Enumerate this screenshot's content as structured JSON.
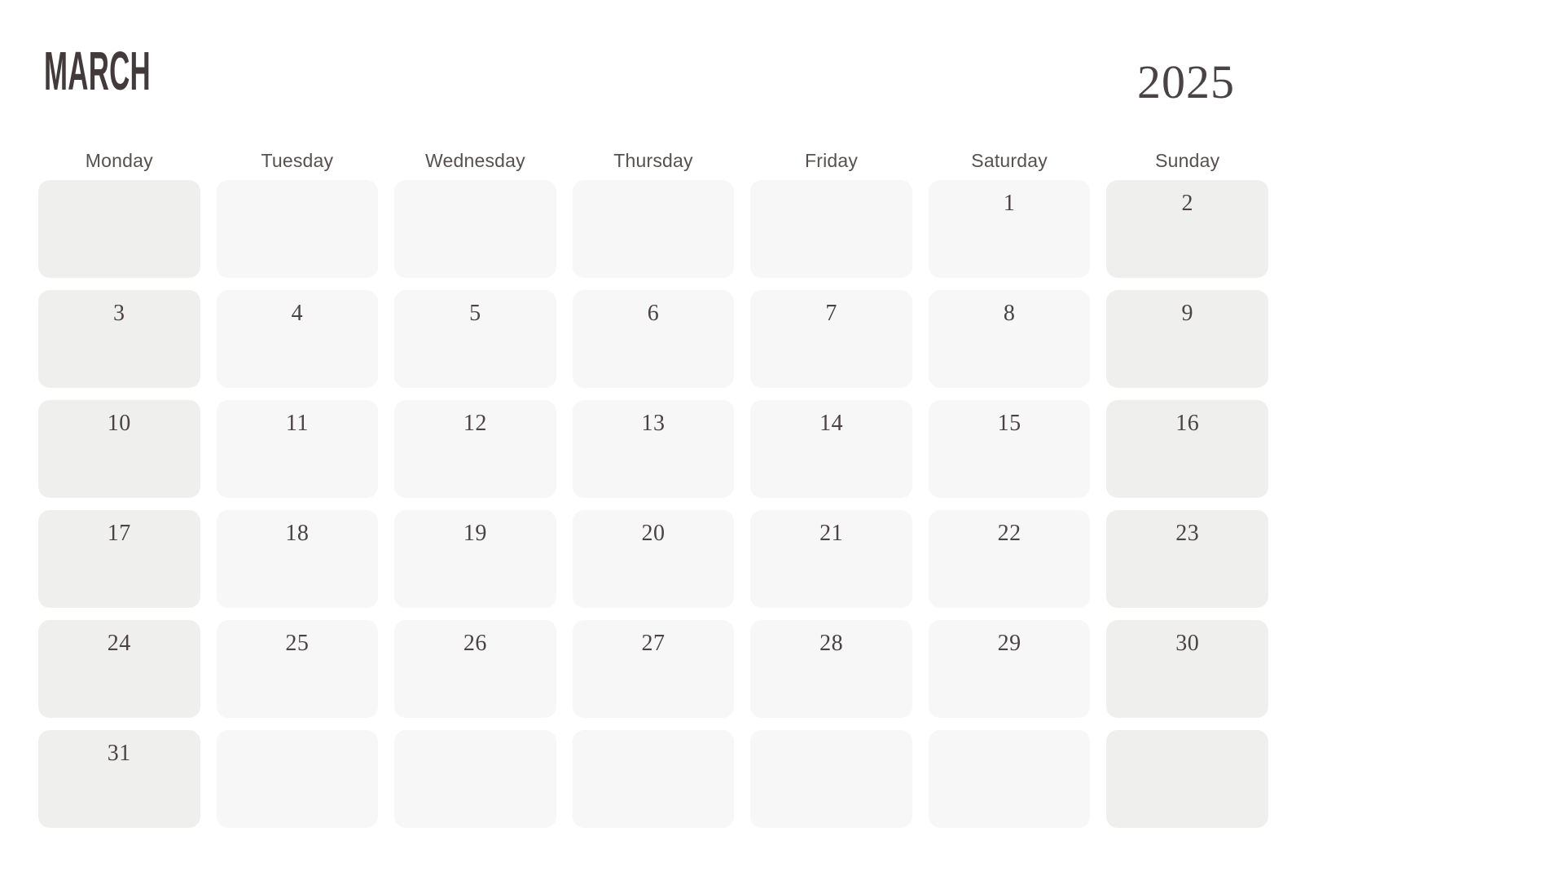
{
  "header": {
    "month": "March",
    "year": "2025"
  },
  "weekdays": [
    "Monday",
    "Tuesday",
    "Wednesday",
    "Thursday",
    "Friday",
    "Saturday",
    "Sunday"
  ],
  "accent_columns": [
    0,
    6
  ],
  "colors": {
    "page_background": "#ffffff",
    "title_text": "#433b3b",
    "year_text": "#4a4244",
    "weekday_text": "#57504f",
    "day_number_text": "#4a4244",
    "cell_default": "#f7f7f7",
    "cell_accent": "#efefee"
  },
  "weeks": [
    {
      "days": [
        "",
        "",
        "",
        "",
        "",
        "1",
        "2"
      ]
    },
    {
      "days": [
        "3",
        "4",
        "5",
        "6",
        "7",
        "8",
        "9"
      ]
    },
    {
      "days": [
        "10",
        "11",
        "12",
        "13",
        "14",
        "15",
        "16"
      ]
    },
    {
      "days": [
        "17",
        "18",
        "19",
        "20",
        "21",
        "22",
        "23"
      ]
    },
    {
      "days": [
        "24",
        "25",
        "26",
        "27",
        "28",
        "29",
        "30"
      ]
    },
    {
      "days": [
        "31",
        "",
        "",
        "",
        "",
        "",
        ""
      ]
    }
  ]
}
